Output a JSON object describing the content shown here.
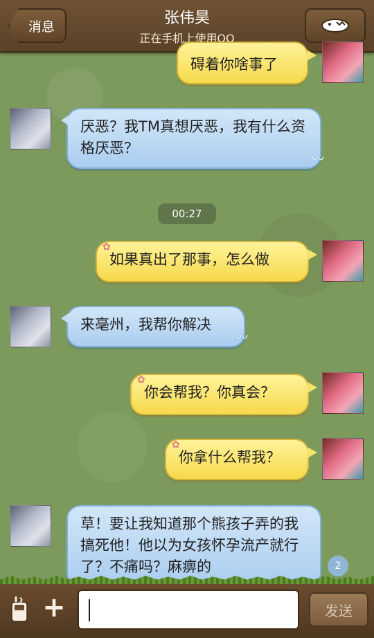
{
  "header": {
    "back_label": "消息",
    "title": "张伟昊",
    "status": "正在手机上使用QQ",
    "menu_icon": "dinosaur-icon"
  },
  "messages": [
    {
      "sender": "me",
      "text": "碍着你啥事了"
    },
    {
      "sender": "other",
      "text": "厌恶？我TM真想厌恶，我有什么资格厌恶？"
    },
    {
      "sender": "me",
      "text": "如果真出了那事，怎么做"
    },
    {
      "sender": "other",
      "text": "来亳州，我帮你解决"
    },
    {
      "sender": "me",
      "text": "你会帮我？你真会？"
    },
    {
      "sender": "me",
      "text": "你拿什么帮我？"
    },
    {
      "sender": "other",
      "text": "草！要让我知道那个熊孩子弄的我搞死他！他以为女孩怀孕流产就行了？不痛吗？麻痹的"
    }
  ],
  "timestamp": "00:27",
  "unread_count": "2",
  "input": {
    "value": ""
  },
  "send_label": "发送",
  "colors": {
    "header": "#5e4428",
    "background": "#7c9a5c",
    "bubble_me": "#f6d94b",
    "bubble_other": "#aacdef"
  }
}
